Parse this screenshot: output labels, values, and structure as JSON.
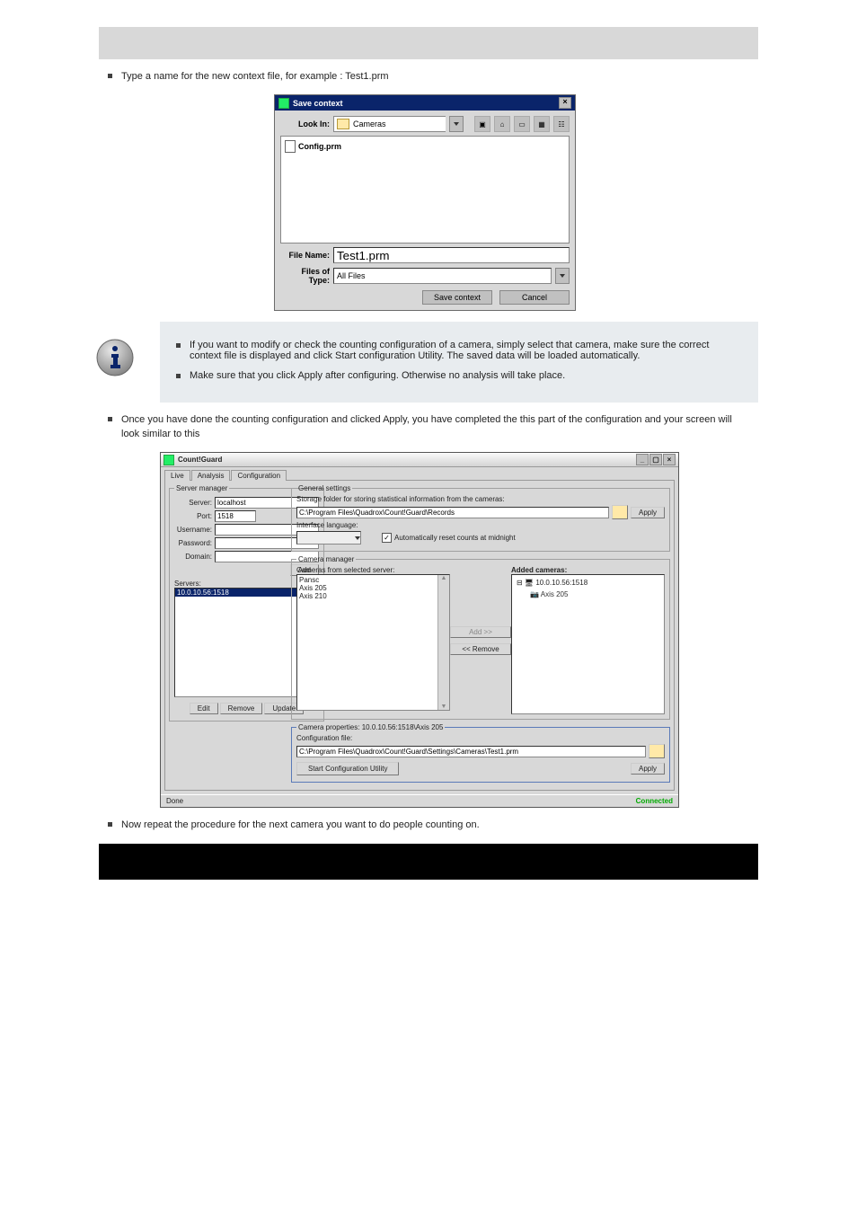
{
  "header_spacer": "",
  "intro_bullet": "Type a name for the new context file, for example : Test1.prm",
  "save_dialog": {
    "title": "Save context",
    "look_in_label": "Look In:",
    "look_in_value": "Cameras",
    "file_item": "Config.prm",
    "file_name_label": "File Name:",
    "file_name_value": "Test1.prm",
    "files_type_label": "Files of Type:",
    "files_type_value": "All Files",
    "save_btn": "Save context",
    "cancel_btn": "Cancel"
  },
  "info": {
    "b1": "If you want to modify or check the counting configuration of a camera, simply select that camera, make sure the correct context file is displayed and click Start configuration Utility. The saved data will be loaded automatically.",
    "b2": "Make sure that you click Apply after configuring. Otherwise no analysis will take place."
  },
  "post_info_bullet": "Once you have done the counting configuration and clicked Apply, you have completed the this part of the configuration and your screen will look similar to this",
  "cfg": {
    "title": "Count!Guard",
    "tabs": {
      "live": "Live",
      "analysis": "Analysis",
      "config": "Configuration"
    },
    "server_manager": {
      "legend": "Server manager",
      "server_label": "Server:",
      "server_value": "localhost",
      "port_label": "Port:",
      "port_value": "1518",
      "user_label": "Username:",
      "pass_label": "Password:",
      "domain_label": "Domain:",
      "add_btn": "Add",
      "servers_label": "Servers:",
      "server_item": "10.0.10.56:1518",
      "edit_btn": "Edit",
      "remove_btn": "Remove",
      "update_btn": "Update"
    },
    "general": {
      "legend": "General settings",
      "storage_label": "Storage folder for storing statistical information from the cameras:",
      "storage_value": "C:\\Program Files\\Quadrox\\Count!Guard\\Records",
      "apply": "Apply",
      "lang_label": "Interface language:",
      "auto_reset": "Automatically reset counts at midnight"
    },
    "cam_mgr": {
      "legend": "Camera manager",
      "from_label": "Cameras from selected server:",
      "items": [
        "Pansc",
        "Axis 205",
        "Axis 210"
      ],
      "add": "Add >>",
      "remove": "<< Remove",
      "added_label": "Added cameras:",
      "tree_root": "10.0.10.56:1518",
      "tree_child": "Axis 205"
    },
    "cam_props": {
      "legend": "Camera properties: 10.0.10.56:1518\\Axis 205",
      "cfg_label": "Configuration file:",
      "cfg_value": "C:\\Program Files\\Quadrox\\Count!Guard\\Settings\\Cameras\\Test1.prm",
      "start_btn": "Start Configuration Utility",
      "apply": "Apply"
    },
    "status_done": "Done",
    "status_conn": "Connected"
  },
  "final_bullet": "Now repeat the procedure for the next camera you want to do people counting on."
}
